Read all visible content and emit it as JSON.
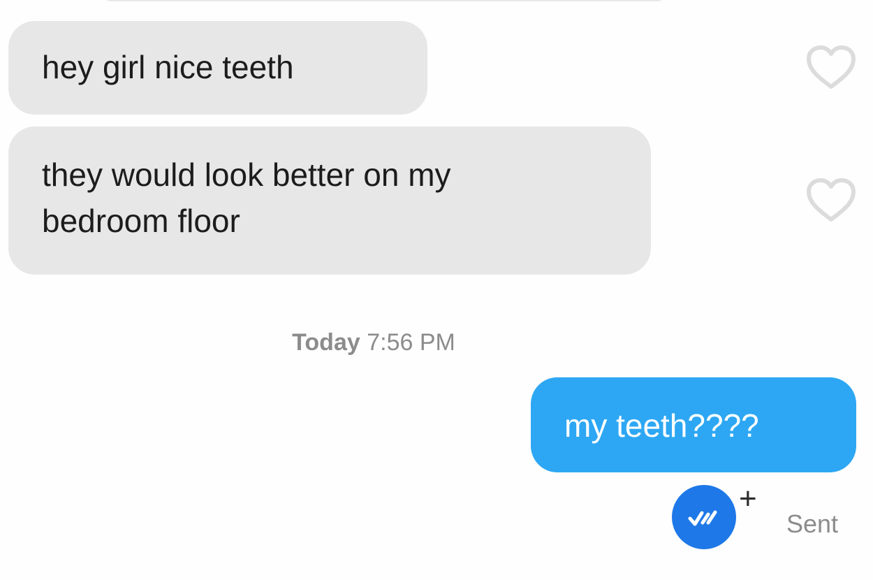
{
  "conversation": {
    "messages": [
      {
        "direction": "incoming",
        "lines": [
          "hey girl nice teeth"
        ]
      },
      {
        "direction": "incoming",
        "lines": [
          "they would look better on my",
          "bedroom floor"
        ]
      }
    ],
    "timestamp": {
      "day": "Today",
      "time": "7:56 PM"
    },
    "outgoing_message": "my teeth????",
    "status": {
      "plus_symbol": "+",
      "label": "Sent"
    }
  },
  "icons": {
    "like": "heart-outline-icon",
    "read_receipt": "double-check-icon"
  },
  "colors": {
    "incoming_bubble": "#e7e7e7",
    "outgoing_bubble": "#2da7f3",
    "status_avatar": "#1e78e8",
    "timestamp_text": "#8c8c8c"
  }
}
